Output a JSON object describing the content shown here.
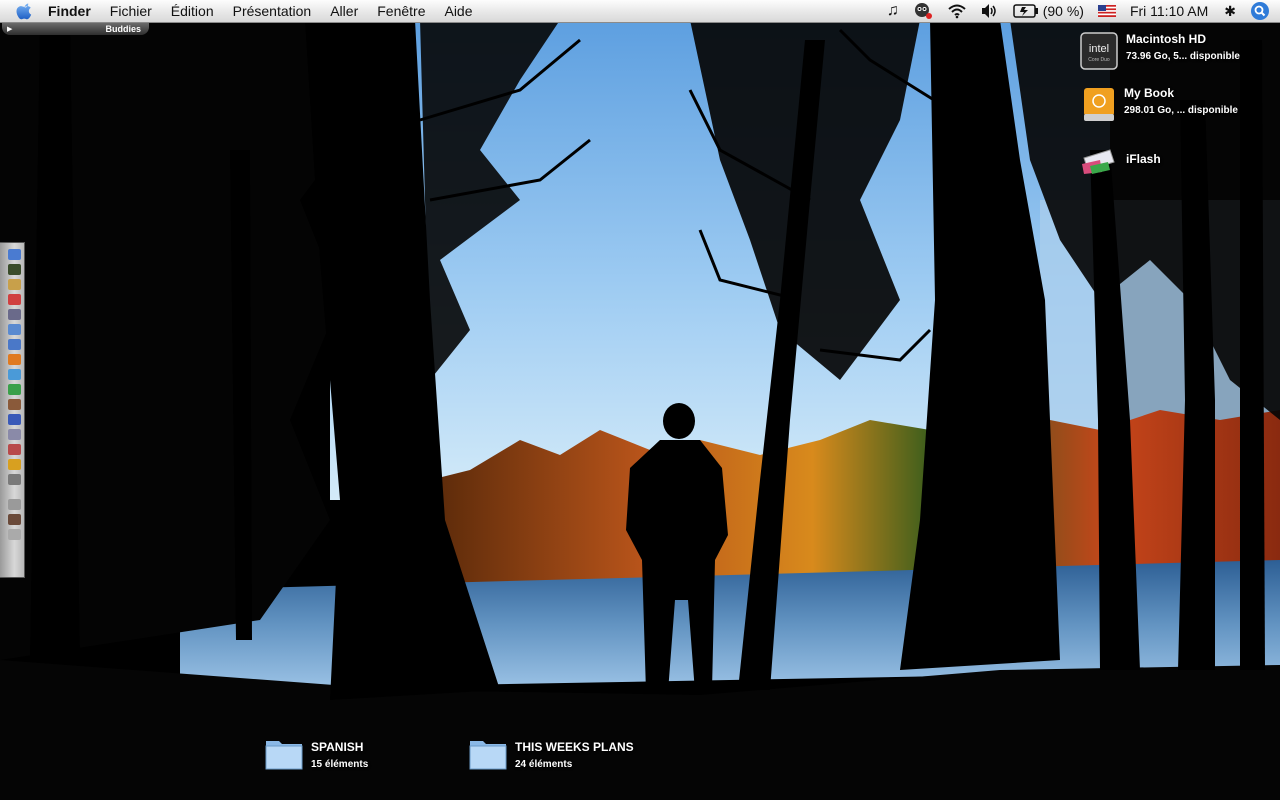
{
  "menubar": {
    "app_name": "Finder",
    "menus": [
      "Fichier",
      "Édition",
      "Présentation",
      "Aller",
      "Fenêtre",
      "Aide"
    ],
    "battery_text": "(90 %)",
    "clock": "Fri 11:10 AM",
    "status_icons": [
      "music-note-icon",
      "robot-icon",
      "wifi-icon",
      "volume-icon",
      "battery-icon",
      "us-flag-icon",
      "bluetooth-icon",
      "spotlight-icon"
    ]
  },
  "buddies": {
    "label": "Buddies"
  },
  "volumes": [
    {
      "name": "Macintosh HD",
      "detail": "73.96 Go, 5... disponible",
      "icon": "intel-hard-drive-icon"
    },
    {
      "name": "My Book",
      "detail": "298.01 Go, ... disponible",
      "icon": "external-drive-icon"
    },
    {
      "name": "iFlash",
      "detail": "",
      "icon": "flash-drive-icon"
    }
  ],
  "folders": [
    {
      "name": "SPANISH",
      "detail": "15 éléments",
      "icon": "folder-icon"
    },
    {
      "name": "THIS WEEKS PLANS",
      "detail": "24 éléments",
      "icon": "folder-icon"
    }
  ],
  "dock": {
    "items": [
      "finder-icon",
      "dashboard-icon",
      "address-book-icon",
      "ical-icon",
      "system-prefs-icon",
      "preview-icon",
      "mail-icon",
      "firefox-icon",
      "safari-icon",
      "chat-icon",
      "photo-icon",
      "itunes-icon",
      "network-icon",
      "scissors-icon",
      "money-icon",
      "calculator-icon",
      "folder-stack-icon",
      "media-icon",
      "trash-icon"
    ],
    "colors": [
      "#4a7bd1",
      "#3a4c2a",
      "#c8a04a",
      "#d04040",
      "#6a6a8a",
      "#5a8ad0",
      "#4a78c8",
      "#e07a20",
      "#4a9ad8",
      "#3aa04a",
      "#8a5a3a",
      "#3a5ab8",
      "#8a8aa8",
      "#b84a4a",
      "#d8a020",
      "#7a7a7a",
      "#9a9a9a",
      "#6a4a3a",
      "#aaaaaa"
    ]
  }
}
